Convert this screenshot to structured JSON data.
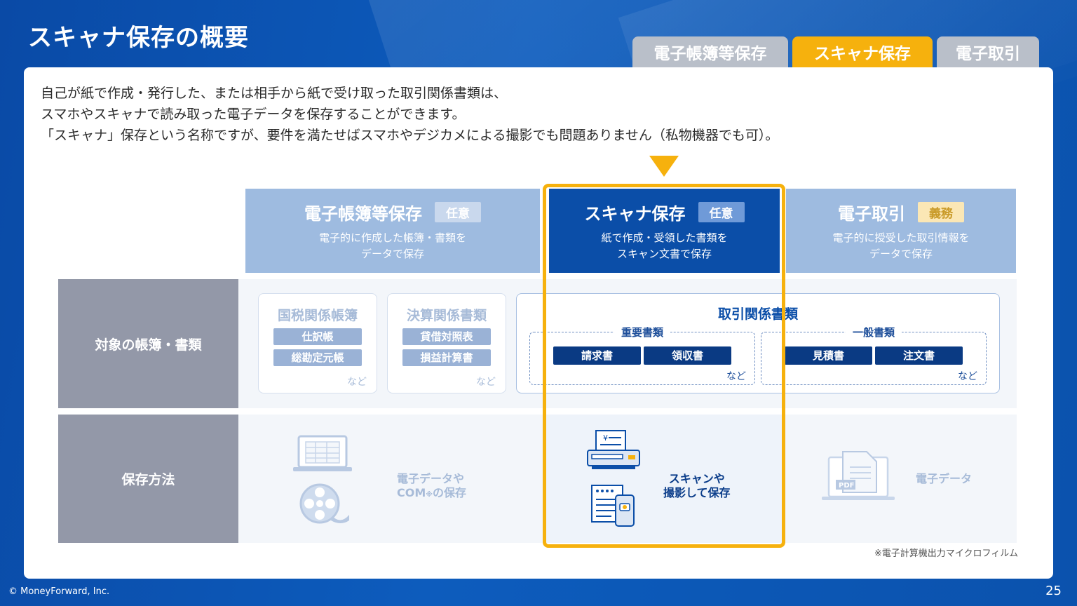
{
  "title": "スキャナ保存の概要",
  "tabs": [
    {
      "label": "電子帳簿等保存",
      "active": false
    },
    {
      "label": "スキャナ保存",
      "active": true
    },
    {
      "label": "電子取引",
      "active": false
    }
  ],
  "intro": [
    "自己が紙で作成・発行した、または相手から紙で受け取った取引関係書類は、",
    "スマホやスキャナで読み取った電子データを保存することができます。",
    "「スキャナ」保存という名称ですが、要件を満たせばスマホやデジカメによる撮影でも問題ありません（私物機器でも可）。"
  ],
  "columns": [
    {
      "title": "電子帳簿等保存",
      "badge": "任意",
      "sub1": "電子的に作成した帳簿・書類を",
      "sub2": "データで保存"
    },
    {
      "title": "スキャナ保存",
      "badge": "任意",
      "sub1": "紙で作成・受領した書類を",
      "sub2": "スキャン文書で保存"
    },
    {
      "title": "電子取引",
      "badge": "義務",
      "sub1": "電子的に授受した取引情報を",
      "sub2": "データで保存"
    }
  ],
  "rows": {
    "target_label": "対象の帳簿・書類",
    "method_label": "保存方法"
  },
  "boxes": {
    "kokuzei": {
      "title": "国税関係帳簿",
      "items": [
        "仕訳帳",
        "総勘定元帳"
      ],
      "etc": "など"
    },
    "kessan": {
      "title": "決算関係書類",
      "items": [
        "貸借対照表",
        "損益計算書"
      ],
      "etc": "など"
    },
    "torihiki": {
      "title": "取引関係書類",
      "important": {
        "label": "重要書類",
        "items": [
          "請求書",
          "領収書"
        ],
        "etc": "など"
      },
      "general": {
        "label": "一般書類",
        "items": [
          "見積書",
          "注文書"
        ],
        "etc": "など"
      }
    }
  },
  "methods": {
    "denshi_line1": "電子データや",
    "denshi_line2_main": "COM",
    "denshi_line2_mark": "※",
    "denshi_line2_rest": "の保存",
    "scan_line1": "スキャンや",
    "scan_line2": "撮影して保存",
    "torihiki": "電子データ"
  },
  "footnote": "※電子計算機出力マイクロフィルム",
  "copyright": "© MoneyForward, Inc.",
  "page_number": "25",
  "colors": {
    "accent": "#f6b10d",
    "primary": "#0b4ea8",
    "light_primary": "#9ebbe0",
    "label_gray": "#9398a8"
  }
}
